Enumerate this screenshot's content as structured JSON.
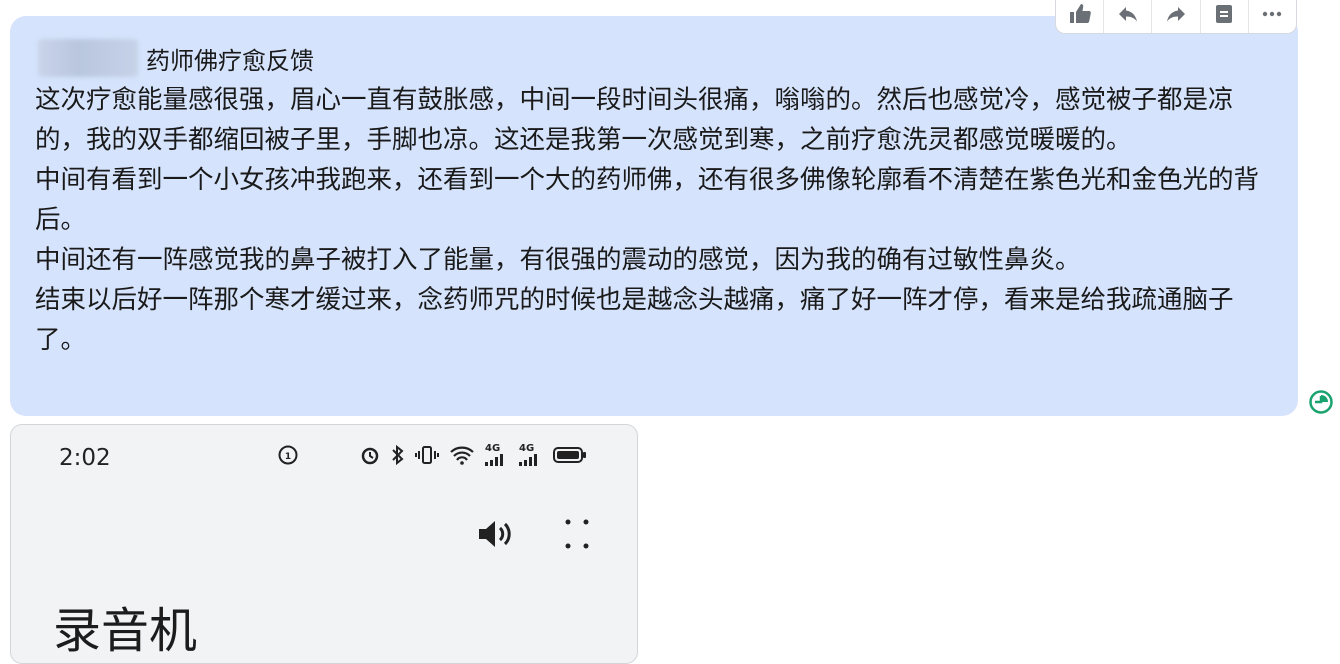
{
  "message": {
    "title": "药师佛疗愈反馈",
    "paragraphs": [
      "这次疗愈能量感很强，眉心一直有鼓胀感，中间一段时间头很痛，嗡嗡的。然后也感觉冷，感觉被子都是凉的，我的双手都缩回被子里，手脚也凉。这还是我第一次感觉到寒，之前疗愈洗灵都感觉暖暖的。",
      "中间有看到一个小女孩冲我跑来，还看到一个大的药师佛，还有很多佛像轮廓看不清楚在紫色光和金色光的背后。",
      "中间还有一阵感觉我的鼻子被打入了能量，有很强的震动的感觉，因为我的确有过敏性鼻炎。",
      "结束以后好一阵那个寒才缓过来，念药师咒的时候也是越念头越痛，痛了好一阵才停，看来是给我疏通脑子了。"
    ],
    "bubble_color": "#d5e3fc"
  },
  "toolbar": {
    "icons": [
      "thumbs-up-icon",
      "reply-icon",
      "forward-icon",
      "bookmark-icon",
      "more-horizontal-icon"
    ]
  },
  "read_status_color": "#1aa36f",
  "phone": {
    "time": "2:02",
    "network_labels": [
      "4G",
      "4G"
    ],
    "app_title": "录音机"
  }
}
